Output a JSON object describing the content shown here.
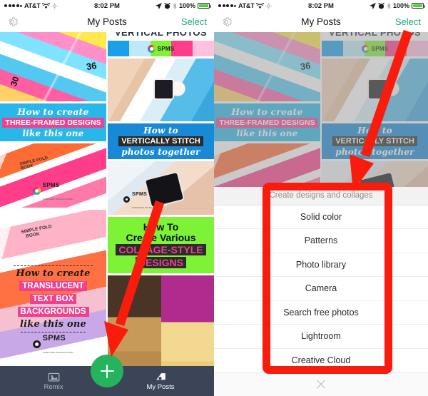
{
  "app": {
    "accent_green": "#19a974",
    "fab_green": "#25b35e",
    "tabbar_color": "#3b4557",
    "annotation_red": "#f91c0c"
  },
  "status_bar": {
    "carrier": "AT&T",
    "time": "8:02 PM",
    "battery_percent": "100%",
    "icons": [
      "signal-dots-icon",
      "wifi-icon",
      "sync-icon",
      "location-arrow-icon",
      "alarm-clock-icon",
      "bluetooth-icon",
      "battery-icon"
    ]
  },
  "nav_bar": {
    "settings_icon": "gear-icon",
    "title": "My Posts",
    "select_label": "Select"
  },
  "posts": {
    "left_column": [
      {
        "id": "three-framed-designs",
        "lines": [
          "How to create",
          "THREE-FRAMED DESIGNS",
          "like this one"
        ],
        "band_color": "#29b6e8"
      },
      {
        "id": "craft-papers-spms",
        "brand": "SPMS",
        "brand_sub": "SOMETHING SPLENDID PRESS"
      },
      {
        "id": "translucent-text-box-backgrounds",
        "lines": [
          "How to create",
          "TRANSLUCENT",
          "TEXT BOX",
          "BACKGROUNDS",
          "like this one"
        ],
        "brand": "SPMS",
        "brand_sub": "SOMETHING SPLENDID PRESS"
      }
    ],
    "right_column": [
      {
        "id": "vertical-photos-header",
        "title": "VERTICAL PHOTOS",
        "brand": "SPMS"
      },
      {
        "id": "poolside-phone-photo"
      },
      {
        "id": "vertically-stitch",
        "lines": [
          "How to",
          "VERTICALLY STITCH",
          "photos together"
        ],
        "band_color": "#1789d6"
      },
      {
        "id": "hand-holding-phone",
        "brand": "SPMS",
        "brand_sub": "SOMETHING SPLENDID PRESS"
      },
      {
        "id": "collage-style-designs",
        "lines": [
          "How To",
          "Create Various",
          "COLLAGE-STYLE",
          "DESIGNS"
        ],
        "band_color": "#7ef236"
      },
      {
        "id": "cocktail-drinks-photo"
      }
    ]
  },
  "tab_bar": {
    "tabs": [
      {
        "label": "Remix",
        "icon": "photos-stack-icon",
        "active": false
      },
      {
        "label": "My Posts",
        "icon": "posts-icon",
        "active": true
      }
    ],
    "create_button": {
      "icon": "plus-icon",
      "label": "+"
    }
  },
  "action_sheet": {
    "header": "Create designs and collages",
    "items": [
      "Solid color",
      "Patterns",
      "Photo library",
      "Camera",
      "Search free photos",
      "Lightroom",
      "Creative Cloud"
    ],
    "close_icon": "close-x-icon"
  },
  "annotations": {
    "left_arrow": "red-arrow-pointing-to-create-button",
    "right_arrow": "red-arrow-pointing-to-action-sheet",
    "highlight_box": "red-rectangle-around-action-sheet-items"
  }
}
